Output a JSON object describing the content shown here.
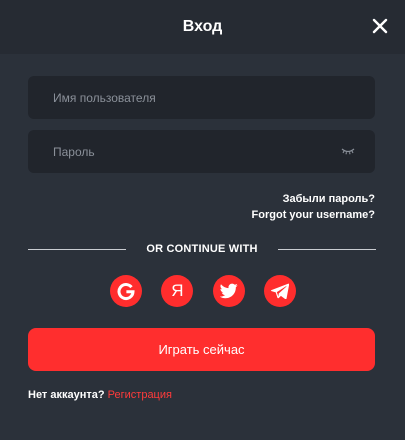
{
  "modal": {
    "title": "Вход",
    "close_icon": "close-icon"
  },
  "form": {
    "username_placeholder": "Имя пользователя",
    "username_value": "",
    "password_placeholder": "Пароль",
    "password_value": "",
    "password_toggle_icon": "eye-closed-icon",
    "forgot_password": "Забыли пароль?",
    "forgot_username": "Forgot your username?"
  },
  "divider": {
    "text": "OR CONTINUE WITH"
  },
  "social": {
    "items": [
      {
        "icon": "google-icon"
      },
      {
        "icon": "yandex-icon",
        "glyph": "Я"
      },
      {
        "icon": "twitter-icon"
      },
      {
        "icon": "telegram-icon"
      }
    ]
  },
  "actions": {
    "play_label": "Играть сейчас"
  },
  "footer": {
    "question": "Нет аккаунта?",
    "register_link": "Регистрация"
  },
  "colors": {
    "background": "#2b313a",
    "header": "#262b33",
    "field": "#21252c",
    "accent": "#ff2e2e"
  }
}
